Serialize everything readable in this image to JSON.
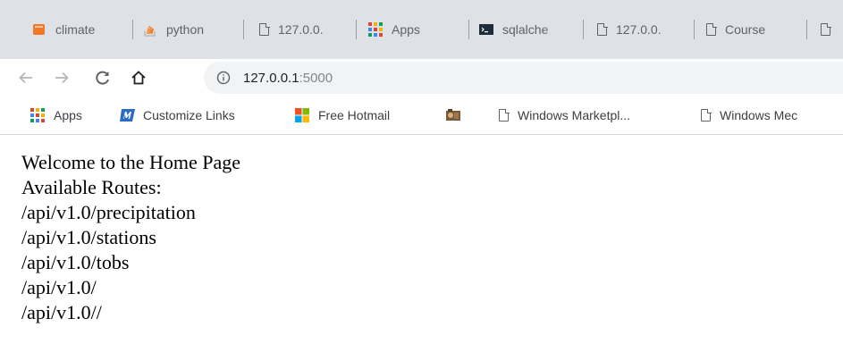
{
  "tabs": [
    {
      "title": "climate",
      "icon": "jupyter-icon"
    },
    {
      "title": "python",
      "icon": "stackoverflow-icon"
    },
    {
      "title": "127.0.0.",
      "icon": "page-icon"
    },
    {
      "title": "Apps",
      "icon": "apps-grid-icon"
    },
    {
      "title": "sqlalche",
      "icon": "terminal-icon"
    },
    {
      "title": "127.0.0.",
      "icon": "page-icon"
    },
    {
      "title": "Course",
      "icon": "page-icon"
    }
  ],
  "toolbar": {
    "url_host": "127.0.0.1",
    "url_port": ":5000"
  },
  "bookmarks": [
    {
      "label": "Apps",
      "icon": "apps-grid-icon"
    },
    {
      "label": "Customize Links",
      "icon": "msn-icon"
    },
    {
      "label": "Free Hotmail",
      "icon": "windows-icon"
    },
    {
      "label": "",
      "icon": "media-icon"
    },
    {
      "label": "Windows Marketpl...",
      "icon": "page-icon"
    },
    {
      "label": "Windows Mec",
      "icon": "page-icon"
    }
  ],
  "page": {
    "heading": "Welcome to the Home Page",
    "routes_label": "Available Routes:",
    "routes": [
      "/api/v1.0/precipitation",
      "/api/v1.0/stations",
      "/api/v1.0/tobs",
      "/api/v1.0/",
      "/api/v1.0//"
    ]
  },
  "colors": {
    "tabstrip": "#dee1e6",
    "omnibox": "#f1f3f4",
    "icon_gray": "#5f6368"
  }
}
